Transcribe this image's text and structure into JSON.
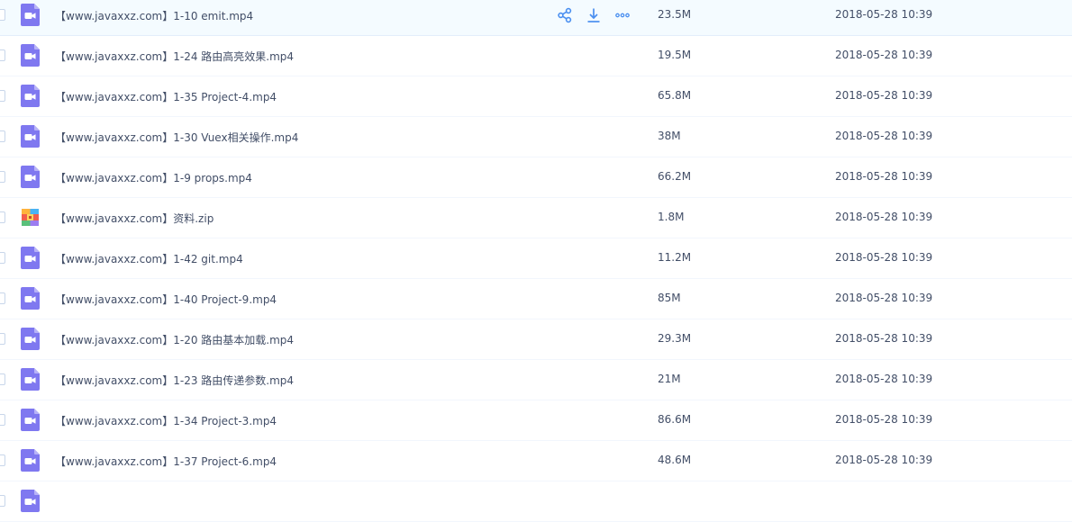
{
  "colors": {
    "video_icon": "#7f78f0",
    "action_icon": "#4a8ff0",
    "row_hover_bg": "#f4fbff",
    "text": "#424e67"
  },
  "files": [
    {
      "name": "【www.javaxxz.com】1-10 emit.mp4",
      "size": "23.5M",
      "date": "2018-05-28 10:39",
      "icon": "video-file-icon"
    },
    {
      "name": "【www.javaxxz.com】1-24 路由高亮效果.mp4",
      "size": "19.5M",
      "date": "2018-05-28 10:39",
      "icon": "video-file-icon"
    },
    {
      "name": "【www.javaxxz.com】1-35 Project-4.mp4",
      "size": "65.8M",
      "date": "2018-05-28 10:39",
      "icon": "video-file-icon"
    },
    {
      "name": "【www.javaxxz.com】1-30 Vuex相关操作.mp4",
      "size": "38M",
      "date": "2018-05-28 10:39",
      "icon": "video-file-icon"
    },
    {
      "name": "【www.javaxxz.com】1-9 props.mp4",
      "size": "66.2M",
      "date": "2018-05-28 10:39",
      "icon": "video-file-icon"
    },
    {
      "name": "【www.javaxxz.com】资料.zip",
      "size": "1.8M",
      "date": "2018-05-28 10:39",
      "icon": "zip-file-icon"
    },
    {
      "name": "【www.javaxxz.com】1-42 git.mp4",
      "size": "11.2M",
      "date": "2018-05-28 10:39",
      "icon": "video-file-icon"
    },
    {
      "name": "【www.javaxxz.com】1-40 Project-9.mp4",
      "size": "85M",
      "date": "2018-05-28 10:39",
      "icon": "video-file-icon"
    },
    {
      "name": "【www.javaxxz.com】1-20 路由基本加载.mp4",
      "size": "29.3M",
      "date": "2018-05-28 10:39",
      "icon": "video-file-icon"
    },
    {
      "name": "【www.javaxxz.com】1-23 路由传递参数.mp4",
      "size": "21M",
      "date": "2018-05-28 10:39",
      "icon": "video-file-icon"
    },
    {
      "name": "【www.javaxxz.com】1-34 Project-3.mp4",
      "size": "86.6M",
      "date": "2018-05-28 10:39",
      "icon": "video-file-icon"
    },
    {
      "name": "【www.javaxxz.com】1-37 Project-6.mp4",
      "size": "48.6M",
      "date": "2018-05-28 10:39",
      "icon": "video-file-icon"
    },
    {
      "name": "",
      "size": "",
      "date": "",
      "icon": "video-file-icon"
    }
  ],
  "row_actions": [
    "share-icon",
    "download-icon",
    "more-icon"
  ]
}
